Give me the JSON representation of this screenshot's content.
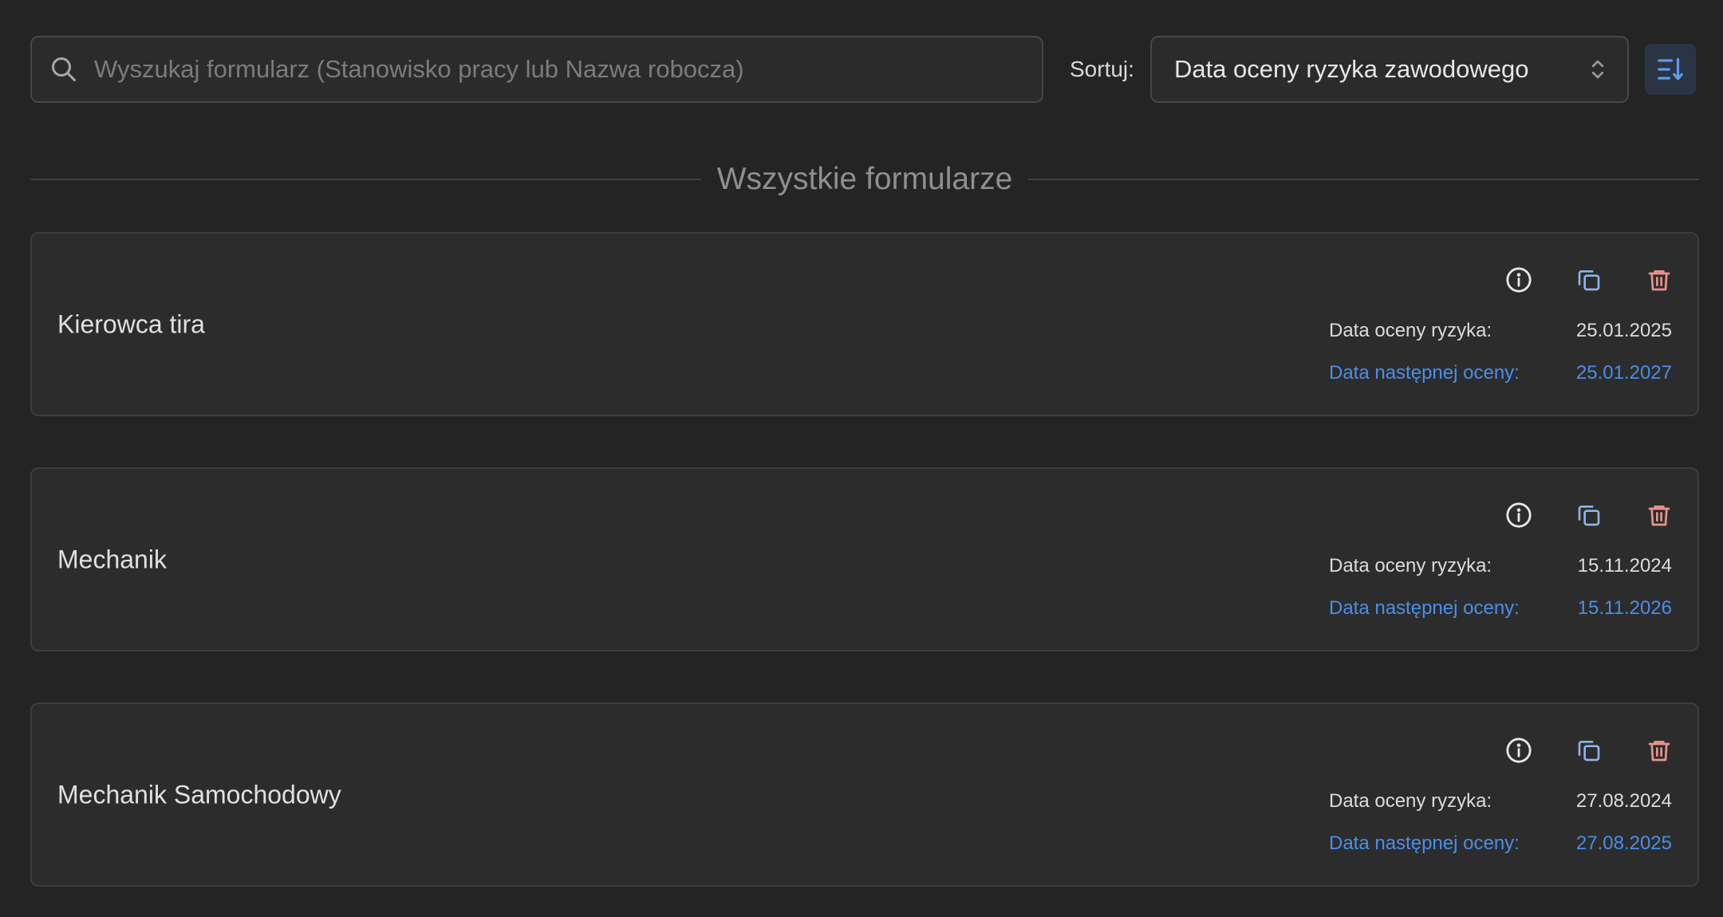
{
  "search": {
    "placeholder": "Wyszukaj formularz (Stanowisko pracy lub Nazwa robocza)",
    "value": ""
  },
  "sort": {
    "label": "Sortuj:",
    "selected": "Data oceny ryzyka zawodowego"
  },
  "section_title": "Wszystkie formularze",
  "colors": {
    "background": "#242424",
    "card": "#2c2c2c",
    "accent_blue": "#4a8ee8",
    "copy_icon": "#8cb4e8",
    "delete_icon": "#e8948c"
  },
  "forms": [
    {
      "name": "Kierowca tira",
      "risk_label": "Data oceny ryzyka:",
      "risk_date": "25.01.2025",
      "next_label": "Data następnej oceny:",
      "next_date": "25.01.2027"
    },
    {
      "name": "Mechanik",
      "risk_label": "Data oceny ryzyka:",
      "risk_date": "15.11.2024",
      "next_label": "Data następnej oceny:",
      "next_date": "15.11.2026"
    },
    {
      "name": "Mechanik Samochodowy",
      "risk_label": "Data oceny ryzyka:",
      "risk_date": "27.08.2024",
      "next_label": "Data następnej oceny:",
      "next_date": "27.08.2025"
    }
  ]
}
